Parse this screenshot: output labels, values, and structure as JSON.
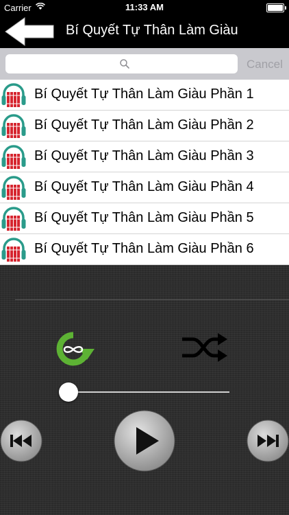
{
  "status_bar": {
    "carrier": "Carrier",
    "time": "11:33 AM"
  },
  "nav": {
    "title": "Bí Quyết Tự Thân Làm Giàu",
    "back_icon": "back-arrow-icon"
  },
  "search": {
    "placeholder": "",
    "cancel_label": "Cancel"
  },
  "tracks": [
    {
      "label": "Bí Quyết Tự Thân Làm Giàu Phần 1",
      "icon": "headphones-book-icon"
    },
    {
      "label": "Bí Quyết Tự Thân Làm Giàu Phần 2",
      "icon": "headphones-book-icon"
    },
    {
      "label": "Bí Quyết Tự Thân Làm Giàu Phần 3",
      "icon": "headphones-book-icon"
    },
    {
      "label": "Bí Quyết Tự Thân Làm Giàu Phần 4",
      "icon": "headphones-book-icon"
    },
    {
      "label": "Bí Quyết Tự Thân Làm Giàu Phần 5",
      "icon": "headphones-book-icon"
    },
    {
      "label": "Bí Quyết Tự Thân Làm Giàu Phần 6",
      "icon": "headphones-book-icon"
    }
  ],
  "player": {
    "progress": 0,
    "repeat_icon": "repeat-infinite-icon",
    "shuffle_icon": "shuffle-icon",
    "prev_icon": "previous-track-icon",
    "play_icon": "play-icon",
    "next_icon": "next-track-icon"
  },
  "colors": {
    "accent_green": "#5db234",
    "headphone_teal": "#2a9b8a",
    "book_red": "#d6252f"
  }
}
